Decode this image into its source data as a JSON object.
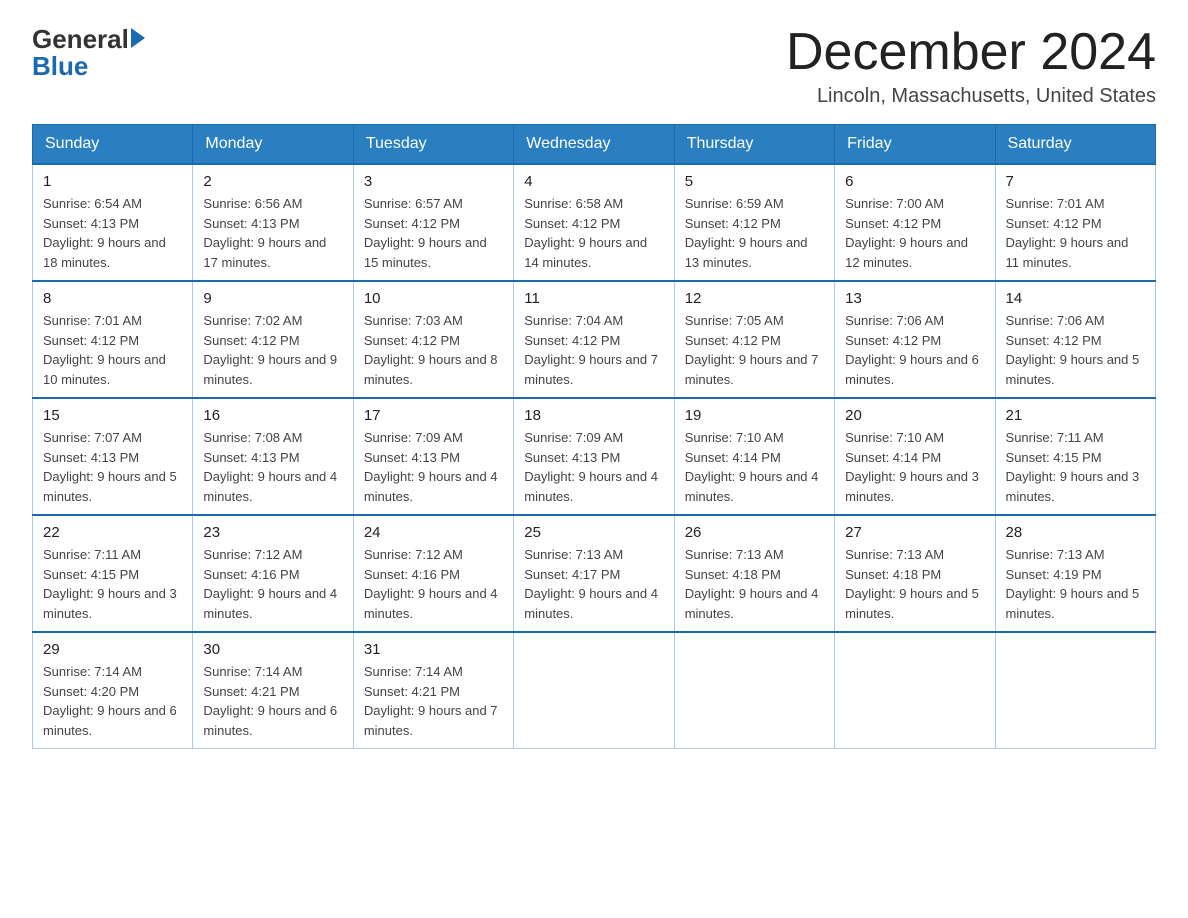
{
  "logo": {
    "general": "General",
    "blue": "Blue"
  },
  "title": "December 2024",
  "location": "Lincoln, Massachusetts, United States",
  "weekdays": [
    "Sunday",
    "Monday",
    "Tuesday",
    "Wednesday",
    "Thursday",
    "Friday",
    "Saturday"
  ],
  "weeks": [
    [
      {
        "day": "1",
        "sunrise": "6:54 AM",
        "sunset": "4:13 PM",
        "daylight": "9 hours and 18 minutes."
      },
      {
        "day": "2",
        "sunrise": "6:56 AM",
        "sunset": "4:13 PM",
        "daylight": "9 hours and 17 minutes."
      },
      {
        "day": "3",
        "sunrise": "6:57 AM",
        "sunset": "4:12 PM",
        "daylight": "9 hours and 15 minutes."
      },
      {
        "day": "4",
        "sunrise": "6:58 AM",
        "sunset": "4:12 PM",
        "daylight": "9 hours and 14 minutes."
      },
      {
        "day": "5",
        "sunrise": "6:59 AM",
        "sunset": "4:12 PM",
        "daylight": "9 hours and 13 minutes."
      },
      {
        "day": "6",
        "sunrise": "7:00 AM",
        "sunset": "4:12 PM",
        "daylight": "9 hours and 12 minutes."
      },
      {
        "day": "7",
        "sunrise": "7:01 AM",
        "sunset": "4:12 PM",
        "daylight": "9 hours and 11 minutes."
      }
    ],
    [
      {
        "day": "8",
        "sunrise": "7:01 AM",
        "sunset": "4:12 PM",
        "daylight": "9 hours and 10 minutes."
      },
      {
        "day": "9",
        "sunrise": "7:02 AM",
        "sunset": "4:12 PM",
        "daylight": "9 hours and 9 minutes."
      },
      {
        "day": "10",
        "sunrise": "7:03 AM",
        "sunset": "4:12 PM",
        "daylight": "9 hours and 8 minutes."
      },
      {
        "day": "11",
        "sunrise": "7:04 AM",
        "sunset": "4:12 PM",
        "daylight": "9 hours and 7 minutes."
      },
      {
        "day": "12",
        "sunrise": "7:05 AM",
        "sunset": "4:12 PM",
        "daylight": "9 hours and 7 minutes."
      },
      {
        "day": "13",
        "sunrise": "7:06 AM",
        "sunset": "4:12 PM",
        "daylight": "9 hours and 6 minutes."
      },
      {
        "day": "14",
        "sunrise": "7:06 AM",
        "sunset": "4:12 PM",
        "daylight": "9 hours and 5 minutes."
      }
    ],
    [
      {
        "day": "15",
        "sunrise": "7:07 AM",
        "sunset": "4:13 PM",
        "daylight": "9 hours and 5 minutes."
      },
      {
        "day": "16",
        "sunrise": "7:08 AM",
        "sunset": "4:13 PM",
        "daylight": "9 hours and 4 minutes."
      },
      {
        "day": "17",
        "sunrise": "7:09 AM",
        "sunset": "4:13 PM",
        "daylight": "9 hours and 4 minutes."
      },
      {
        "day": "18",
        "sunrise": "7:09 AM",
        "sunset": "4:13 PM",
        "daylight": "9 hours and 4 minutes."
      },
      {
        "day": "19",
        "sunrise": "7:10 AM",
        "sunset": "4:14 PM",
        "daylight": "9 hours and 4 minutes."
      },
      {
        "day": "20",
        "sunrise": "7:10 AM",
        "sunset": "4:14 PM",
        "daylight": "9 hours and 3 minutes."
      },
      {
        "day": "21",
        "sunrise": "7:11 AM",
        "sunset": "4:15 PM",
        "daylight": "9 hours and 3 minutes."
      }
    ],
    [
      {
        "day": "22",
        "sunrise": "7:11 AM",
        "sunset": "4:15 PM",
        "daylight": "9 hours and 3 minutes."
      },
      {
        "day": "23",
        "sunrise": "7:12 AM",
        "sunset": "4:16 PM",
        "daylight": "9 hours and 4 minutes."
      },
      {
        "day": "24",
        "sunrise": "7:12 AM",
        "sunset": "4:16 PM",
        "daylight": "9 hours and 4 minutes."
      },
      {
        "day": "25",
        "sunrise": "7:13 AM",
        "sunset": "4:17 PM",
        "daylight": "9 hours and 4 minutes."
      },
      {
        "day": "26",
        "sunrise": "7:13 AM",
        "sunset": "4:18 PM",
        "daylight": "9 hours and 4 minutes."
      },
      {
        "day": "27",
        "sunrise": "7:13 AM",
        "sunset": "4:18 PM",
        "daylight": "9 hours and 5 minutes."
      },
      {
        "day": "28",
        "sunrise": "7:13 AM",
        "sunset": "4:19 PM",
        "daylight": "9 hours and 5 minutes."
      }
    ],
    [
      {
        "day": "29",
        "sunrise": "7:14 AM",
        "sunset": "4:20 PM",
        "daylight": "9 hours and 6 minutes."
      },
      {
        "day": "30",
        "sunrise": "7:14 AM",
        "sunset": "4:21 PM",
        "daylight": "9 hours and 6 minutes."
      },
      {
        "day": "31",
        "sunrise": "7:14 AM",
        "sunset": "4:21 PM",
        "daylight": "9 hours and 7 minutes."
      },
      null,
      null,
      null,
      null
    ]
  ]
}
